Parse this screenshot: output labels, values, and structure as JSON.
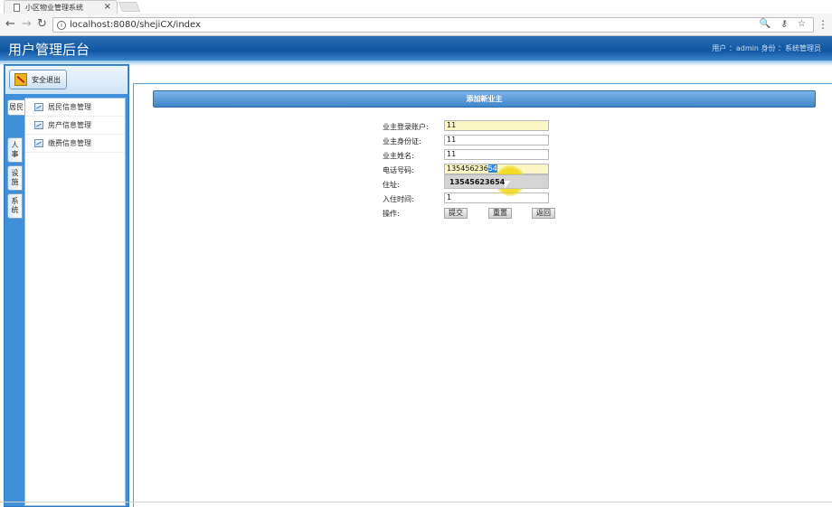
{
  "browser": {
    "tab_title": "小区物业管理系统",
    "tab_close": "×",
    "url": "localhost:8080/shejiCX/index",
    "omni_icons": "🔍 ⚷ ☆",
    "menu": "⋮"
  },
  "header": {
    "title": "用户管理后台",
    "user_info": "用户 ：admin   身份 ：系统管理员"
  },
  "sidebar": {
    "logout_label": "安全退出",
    "vtabs": [
      "居民",
      "人事",
      "设施",
      "系统"
    ],
    "items": [
      "居民信息管理",
      "房产信息管理",
      "缴费信息管理"
    ]
  },
  "form": {
    "title": "添加新业主",
    "fields": [
      {
        "label": "业主登录账户:",
        "value": "11",
        "filled": true
      },
      {
        "label": "业主身份证:",
        "value": "11",
        "filled": false
      },
      {
        "label": "业主姓名:",
        "value": "11",
        "filled": false
      },
      {
        "label": "电话号码:",
        "value_plain": "13545623654",
        "value_selected": "54",
        "filled": true
      },
      {
        "label": "住址:",
        "value": "",
        "filled": false
      },
      {
        "label": "入住时间:",
        "value": "1",
        "filled": false
      }
    ],
    "autocomplete_suggestion": "13545623654",
    "actions_label": "操作:",
    "buttons": [
      "提交",
      "重置",
      "返回"
    ]
  }
}
